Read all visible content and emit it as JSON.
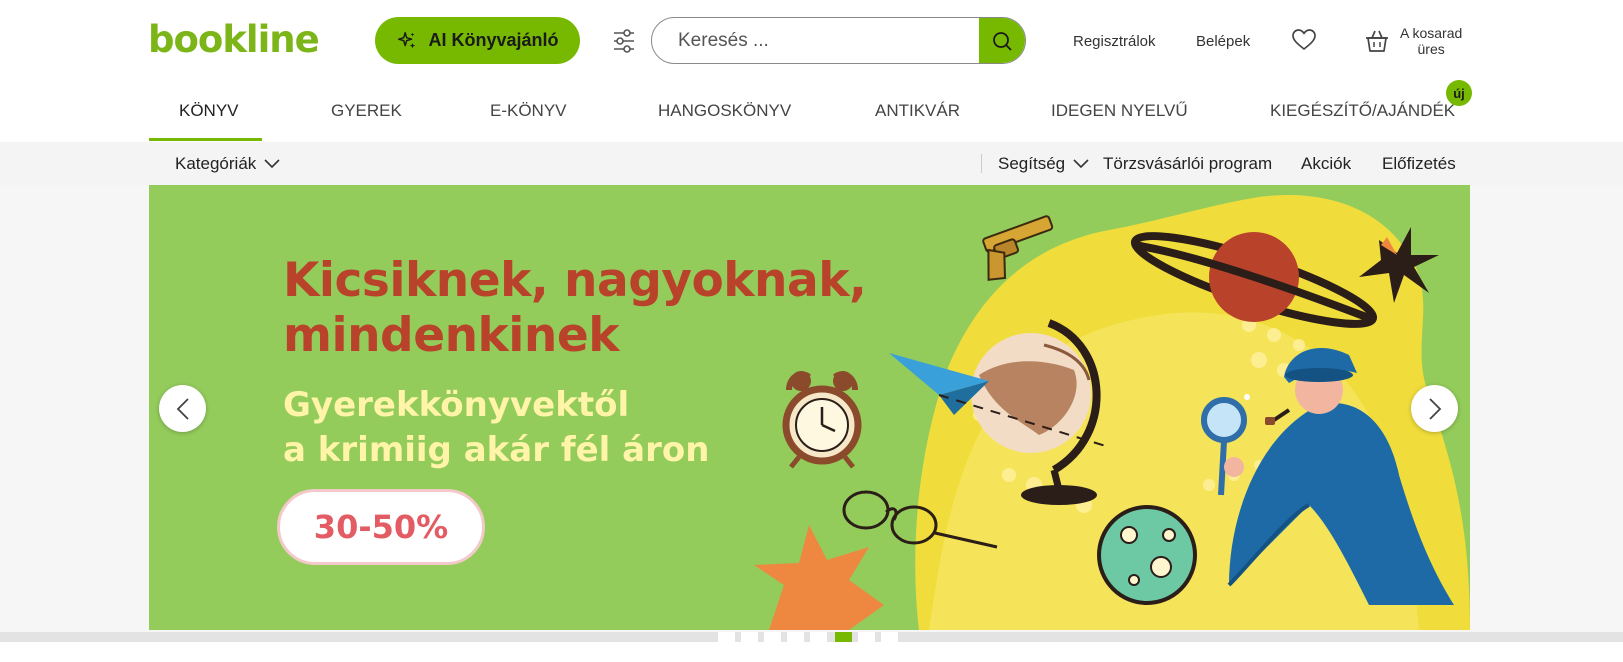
{
  "header": {
    "logo": "bookline",
    "ai_button_label": "AI Könyvajánló",
    "search_placeholder": "Keresés ...",
    "register_label": "Regisztrálok",
    "login_label": "Belépek",
    "cart_line1": "A kosarad",
    "cart_line2": "üres"
  },
  "nav": {
    "items": [
      {
        "label": "KÖNYV"
      },
      {
        "label": "GYEREK"
      },
      {
        "label": "E-KÖNYV"
      },
      {
        "label": "HANGOSKÖNYV"
      },
      {
        "label": "ANTIKVÁR"
      },
      {
        "label": "IDEGEN NYELVŰ"
      },
      {
        "label": "KIEGÉSZÍTŐ/AJÁNDÉK"
      }
    ],
    "active_index": 0,
    "new_badge": "új"
  },
  "subnav": {
    "categories_label": "Kategóriák",
    "help_label": "Segítség",
    "loyalty_label": "Törzsvásárlói program",
    "deals_label": "Akciók",
    "subscription_label": "Előfizetés"
  },
  "banner": {
    "headline_line1": "Kicsiknek, nagyoknak,",
    "headline_line2": "mindenkinek",
    "subline1": "Gyerekkönyvektől",
    "subline2": "a krimiig akár fél áron",
    "discount": "30-50%"
  },
  "carousel": {
    "slide_count": 8,
    "active_slide": 5
  },
  "colors": {
    "brand_green": "#76b900",
    "banner_bg": "#94cc5c",
    "headline": "#b8432a",
    "subline": "#fff4a8",
    "discount_text": "#e35c63"
  },
  "icons": [
    "sparkle-icon",
    "filter-icon",
    "search-icon",
    "heart-icon",
    "cart-icon",
    "chevron-down-icon",
    "chevron-left-icon",
    "chevron-right-icon"
  ]
}
